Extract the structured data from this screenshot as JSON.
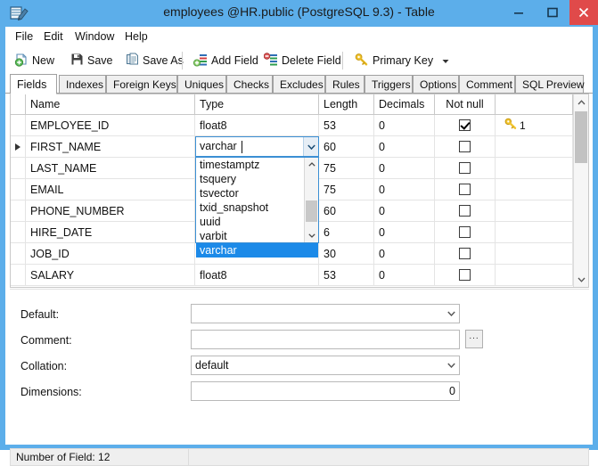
{
  "window": {
    "title": "employees @HR.public (PostgreSQL 9.3) - Table",
    "app_icon": "table-edit-icon",
    "accent_color": "#5caeea",
    "close_color": "#e04a4a",
    "controls": {
      "minimize": "minimize-icon",
      "maximize": "maximize-icon",
      "close": "close-icon"
    }
  },
  "menubar": {
    "items": [
      {
        "label": "File"
      },
      {
        "label": "Edit"
      },
      {
        "label": "Window"
      },
      {
        "label": "Help"
      }
    ]
  },
  "toolbar": {
    "buttons": [
      {
        "label": "New",
        "icon": "new-document-icon"
      },
      {
        "label": "Save",
        "icon": "floppy-disk-icon"
      },
      {
        "label": "Save As",
        "icon": "save-as-icon"
      },
      {
        "label": "Add Field",
        "icon": "add-field-icon"
      },
      {
        "label": "Delete Field",
        "icon": "delete-field-icon"
      },
      {
        "label": "Primary Key",
        "icon": "key-icon",
        "has_dropdown": true
      }
    ]
  },
  "tabs": {
    "active": "Fields",
    "items": [
      {
        "label": "Fields"
      },
      {
        "label": "Indexes"
      },
      {
        "label": "Foreign Keys"
      },
      {
        "label": "Uniques"
      },
      {
        "label": "Checks"
      },
      {
        "label": "Excludes"
      },
      {
        "label": "Rules"
      },
      {
        "label": "Triggers"
      },
      {
        "label": "Options"
      },
      {
        "label": "Comment"
      },
      {
        "label": "SQL Preview"
      }
    ]
  },
  "grid": {
    "columns": [
      "Name",
      "Type",
      "Length",
      "Decimals",
      "Not null",
      ""
    ],
    "selected_row_index": 1,
    "rows": [
      {
        "name": "EMPLOYEE_ID",
        "type": "float8",
        "length": "53",
        "decimals": "0",
        "not_null": true,
        "key": "1"
      },
      {
        "name": "FIRST_NAME",
        "type": "varchar",
        "length": "60",
        "decimals": "0",
        "not_null": false,
        "key": ""
      },
      {
        "name": "LAST_NAME",
        "type": "",
        "length": "75",
        "decimals": "0",
        "not_null": false,
        "key": ""
      },
      {
        "name": "EMAIL",
        "type": "",
        "length": "75",
        "decimals": "0",
        "not_null": false,
        "key": ""
      },
      {
        "name": "PHONE_NUMBER",
        "type": "",
        "length": "60",
        "decimals": "0",
        "not_null": false,
        "key": ""
      },
      {
        "name": "HIRE_DATE",
        "type": "",
        "length": "6",
        "decimals": "0",
        "not_null": false,
        "key": ""
      },
      {
        "name": "JOB_ID",
        "type": "",
        "length": "30",
        "decimals": "0",
        "not_null": false,
        "key": ""
      },
      {
        "name": "SALARY",
        "type": "float8",
        "length": "53",
        "decimals": "0",
        "not_null": false,
        "key": ""
      }
    ]
  },
  "type_editor": {
    "value": "varchar",
    "dropdown_open": true,
    "dropdown_selected": "varchar",
    "options": [
      "timestamptz",
      "tsquery",
      "tsvector",
      "txid_snapshot",
      "uuid",
      "varbit",
      "varchar"
    ]
  },
  "detail": {
    "fields": [
      {
        "label": "Default:",
        "value": "",
        "kind": "combo"
      },
      {
        "label": "Comment:",
        "value": "",
        "kind": "text-with-button",
        "button": "..."
      },
      {
        "label": "Collation:",
        "value": "default",
        "kind": "combo"
      },
      {
        "label": "Dimensions:",
        "value": "0",
        "kind": "number"
      }
    ]
  },
  "statusbar": {
    "text": "Number of Field: 12"
  }
}
